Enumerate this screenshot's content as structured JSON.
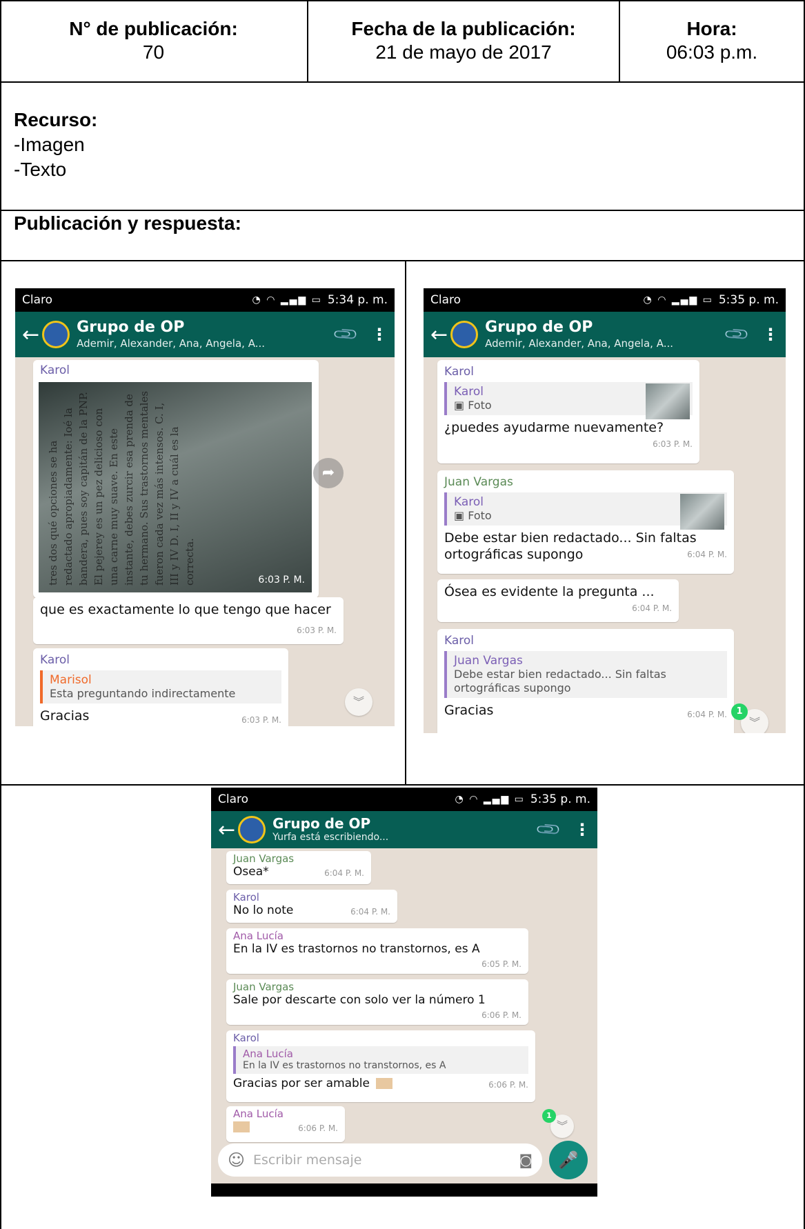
{
  "header": {
    "pub_label": "N°  de publicación:",
    "pub_value": "70",
    "date_label": "Fecha de la publicación:",
    "date_value": "21 de mayo de 2017",
    "hour_label": "Hora:",
    "hour_value": "06:03 p.m."
  },
  "resource": {
    "label": "Recurso:",
    "items": [
      "-Imagen",
      "-Texto"
    ]
  },
  "publication_label": "Publicación y respuesta:",
  "shot1": {
    "carrier": "Claro",
    "status_time": "5:34 p. m.",
    "group_title": "Grupo de OP",
    "group_sub": "Ademir, Alexander, Ana, Angela, A...",
    "photo_sender": "Karol",
    "photo_time": "6:03 P. M.",
    "photo_text": "tres dos  qué opciones se ha redactado apropiadamente: Ioé la bandera, pues soy capitán de la PNP. El pejerey es un pez delicioso con una carne muy suave. En este instante, debes zurcir esa prenda de tu hermano. Sus trastornos mentales fueron cada vez más intensos. C. I, III y IV  D. I, II y IV  a cuál es la correcta.",
    "msg1_text": "que es exactamente lo que tengo que hacer",
    "msg1_time": "6:03 P. M.",
    "msg2_sender": "Karol",
    "msg2_quote_name": "Marisol",
    "msg2_quote_text": "Esta preguntando indirectamente",
    "msg2_text": "Gracias",
    "msg2_time": "6:03 P. M."
  },
  "shot2": {
    "carrier": "Claro",
    "status_time": "5:35 p. m.",
    "group_title": "Grupo de OP",
    "group_sub": "Ademir, Alexander, Ana, Angela, A...",
    "m1_sender": "Karol",
    "m1_quote_name": "Karol",
    "m1_quote_text": "Foto",
    "m1_text": "¿puedes ayudarme nuevamente?",
    "m1_time": "6:03 P. M.",
    "m2_sender": "Juan Vargas",
    "m2_quote_name": "Karol",
    "m2_quote_text": "Foto",
    "m2_text": "Debe estar bien redactado... Sin faltas ortográficas supongo",
    "m2_time": "6:04 P. M.",
    "m3_text": "Ósea es evidente la pregunta ...",
    "m3_time": "6:04 P. M.",
    "m4_sender": "Karol",
    "m4_quote_name": "Juan Vargas",
    "m4_quote_text": "Debe estar bien redactado... Sin faltas ortográficas supongo",
    "m4_text": "Gracias",
    "m4_time": "6:04 P. M.",
    "badge": "1"
  },
  "shot3": {
    "carrier": "Claro",
    "status_time": "5:35 p. m.",
    "group_title": "Grupo de OP",
    "group_sub": "Yurfa está escribiendo...",
    "m1_sender": "Juan Vargas",
    "m1_text": "Osea*",
    "m1_time": "6:04 P. M.",
    "m2_sender": "Karol",
    "m2_text": "No lo note",
    "m2_time": "6:04 P. M.",
    "m3_sender": "Ana Lucía",
    "m3_text": "En la IV es trastornos no transtornos, es A",
    "m3_time": "6:05 P. M.",
    "m4_sender": "Juan Vargas",
    "m4_text": "Sale por descarte con solo ver la número 1",
    "m4_time": "6:06 P. M.",
    "m5_sender": "Karol",
    "m5_quote_name": "Ana Lucía",
    "m5_quote_text": "En la IV es trastornos no transtornos, es A",
    "m5_text": "Gracias por ser amable",
    "m5_time": "6:06 P. M.",
    "m6_sender": "Ana Lucía",
    "m6_time": "6:06 P. M.",
    "badge": "1",
    "composer_placeholder": "Escribir mensaje"
  }
}
